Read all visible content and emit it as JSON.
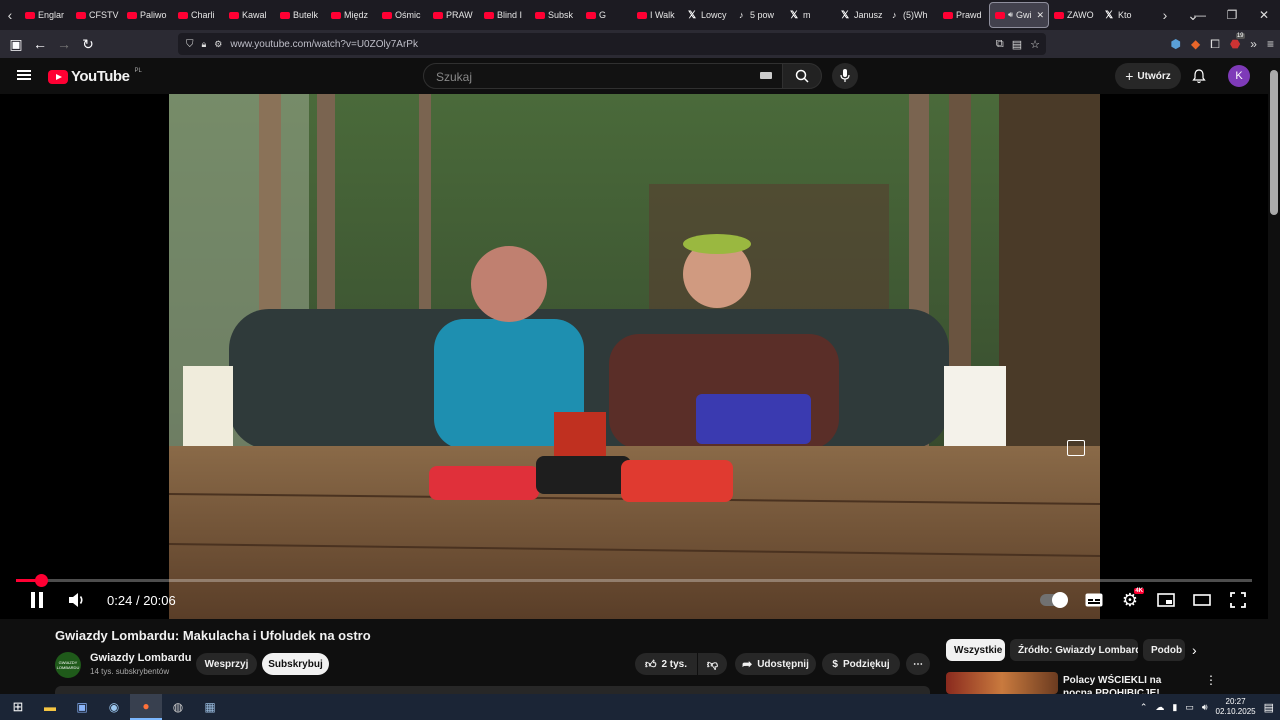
{
  "browser": {
    "tabs": [
      {
        "label": "Englar",
        "icon": "youtube-icon"
      },
      {
        "label": "CFSTV",
        "icon": "youtube-icon"
      },
      {
        "label": "Paliwo",
        "icon": "youtube-icon"
      },
      {
        "label": "Charli",
        "icon": "youtube-icon"
      },
      {
        "label": "Kawal",
        "icon": "youtube-icon"
      },
      {
        "label": "Butelk",
        "icon": "youtube-icon"
      },
      {
        "label": "Międz",
        "icon": "youtube-icon"
      },
      {
        "label": "Ośmic",
        "icon": "youtube-icon"
      },
      {
        "label": "PRAW",
        "icon": "youtube-icon"
      },
      {
        "label": "Blind I",
        "icon": "youtube-icon"
      },
      {
        "label": "Subsk",
        "icon": "youtube-icon"
      },
      {
        "label": "G",
        "icon": "youtube-icon"
      },
      {
        "label": "I Walk",
        "icon": "youtube-icon"
      },
      {
        "label": "Lowcy",
        "icon": "x-icon"
      },
      {
        "label": "5 pow",
        "icon": "tiktok-icon"
      },
      {
        "label": "m",
        "icon": "x-icon"
      },
      {
        "label": "Janusz",
        "icon": "x-icon"
      },
      {
        "label": "(5)Wh",
        "icon": "tiktok-icon"
      },
      {
        "label": "Prawd",
        "icon": "youtube-icon"
      },
      {
        "label": "Gwi",
        "icon": "youtube-icon",
        "active": true
      },
      {
        "label": "ZAWO",
        "icon": "youtube-icon"
      },
      {
        "label": "Kto",
        "icon": "x-icon"
      }
    ],
    "url": "www.youtube.com/watch?v=U0ZOly7ArPk",
    "extension_badge": "19"
  },
  "youtube": {
    "logo_text": "YouTube",
    "country_code": "PL",
    "search_placeholder": "Szukaj",
    "create_label": "Utwórz",
    "avatar_letter": "K"
  },
  "player": {
    "progress": 0.0199,
    "time_current": "0:24",
    "time_total": "20:06",
    "quality_badge": "4K",
    "time_separator": "/"
  },
  "video": {
    "title": "Gwiazdy Lombardu: Makulacha i Ufoludek na ostro",
    "channel_name": "Gwiazdy Lombardu",
    "channel_avatar_text": "GWIAZDY LOMBARDU",
    "subscribers": "14 tys. subskrybentów",
    "support_label": "Wesprzyj",
    "subscribe_label": "Subskrybuj",
    "likes": "2 tys.",
    "share_label": "Udostępnij",
    "thanks_label": "Podziękuj"
  },
  "recommendations": {
    "chips": [
      "Wszystkie",
      "Źródło: Gwiazdy Lombardu",
      "Podob"
    ],
    "first_title": "Polacy WŚCIEKLI na nocną PROHIBICJĘ! POLSKA nie"
  },
  "taskbar": {
    "time": "20:27",
    "date": "02.10.2025"
  },
  "colors": {
    "brand_red": "#ff0033",
    "page_bg": "#0f0f0f",
    "avatar": "#7e3ab8"
  }
}
